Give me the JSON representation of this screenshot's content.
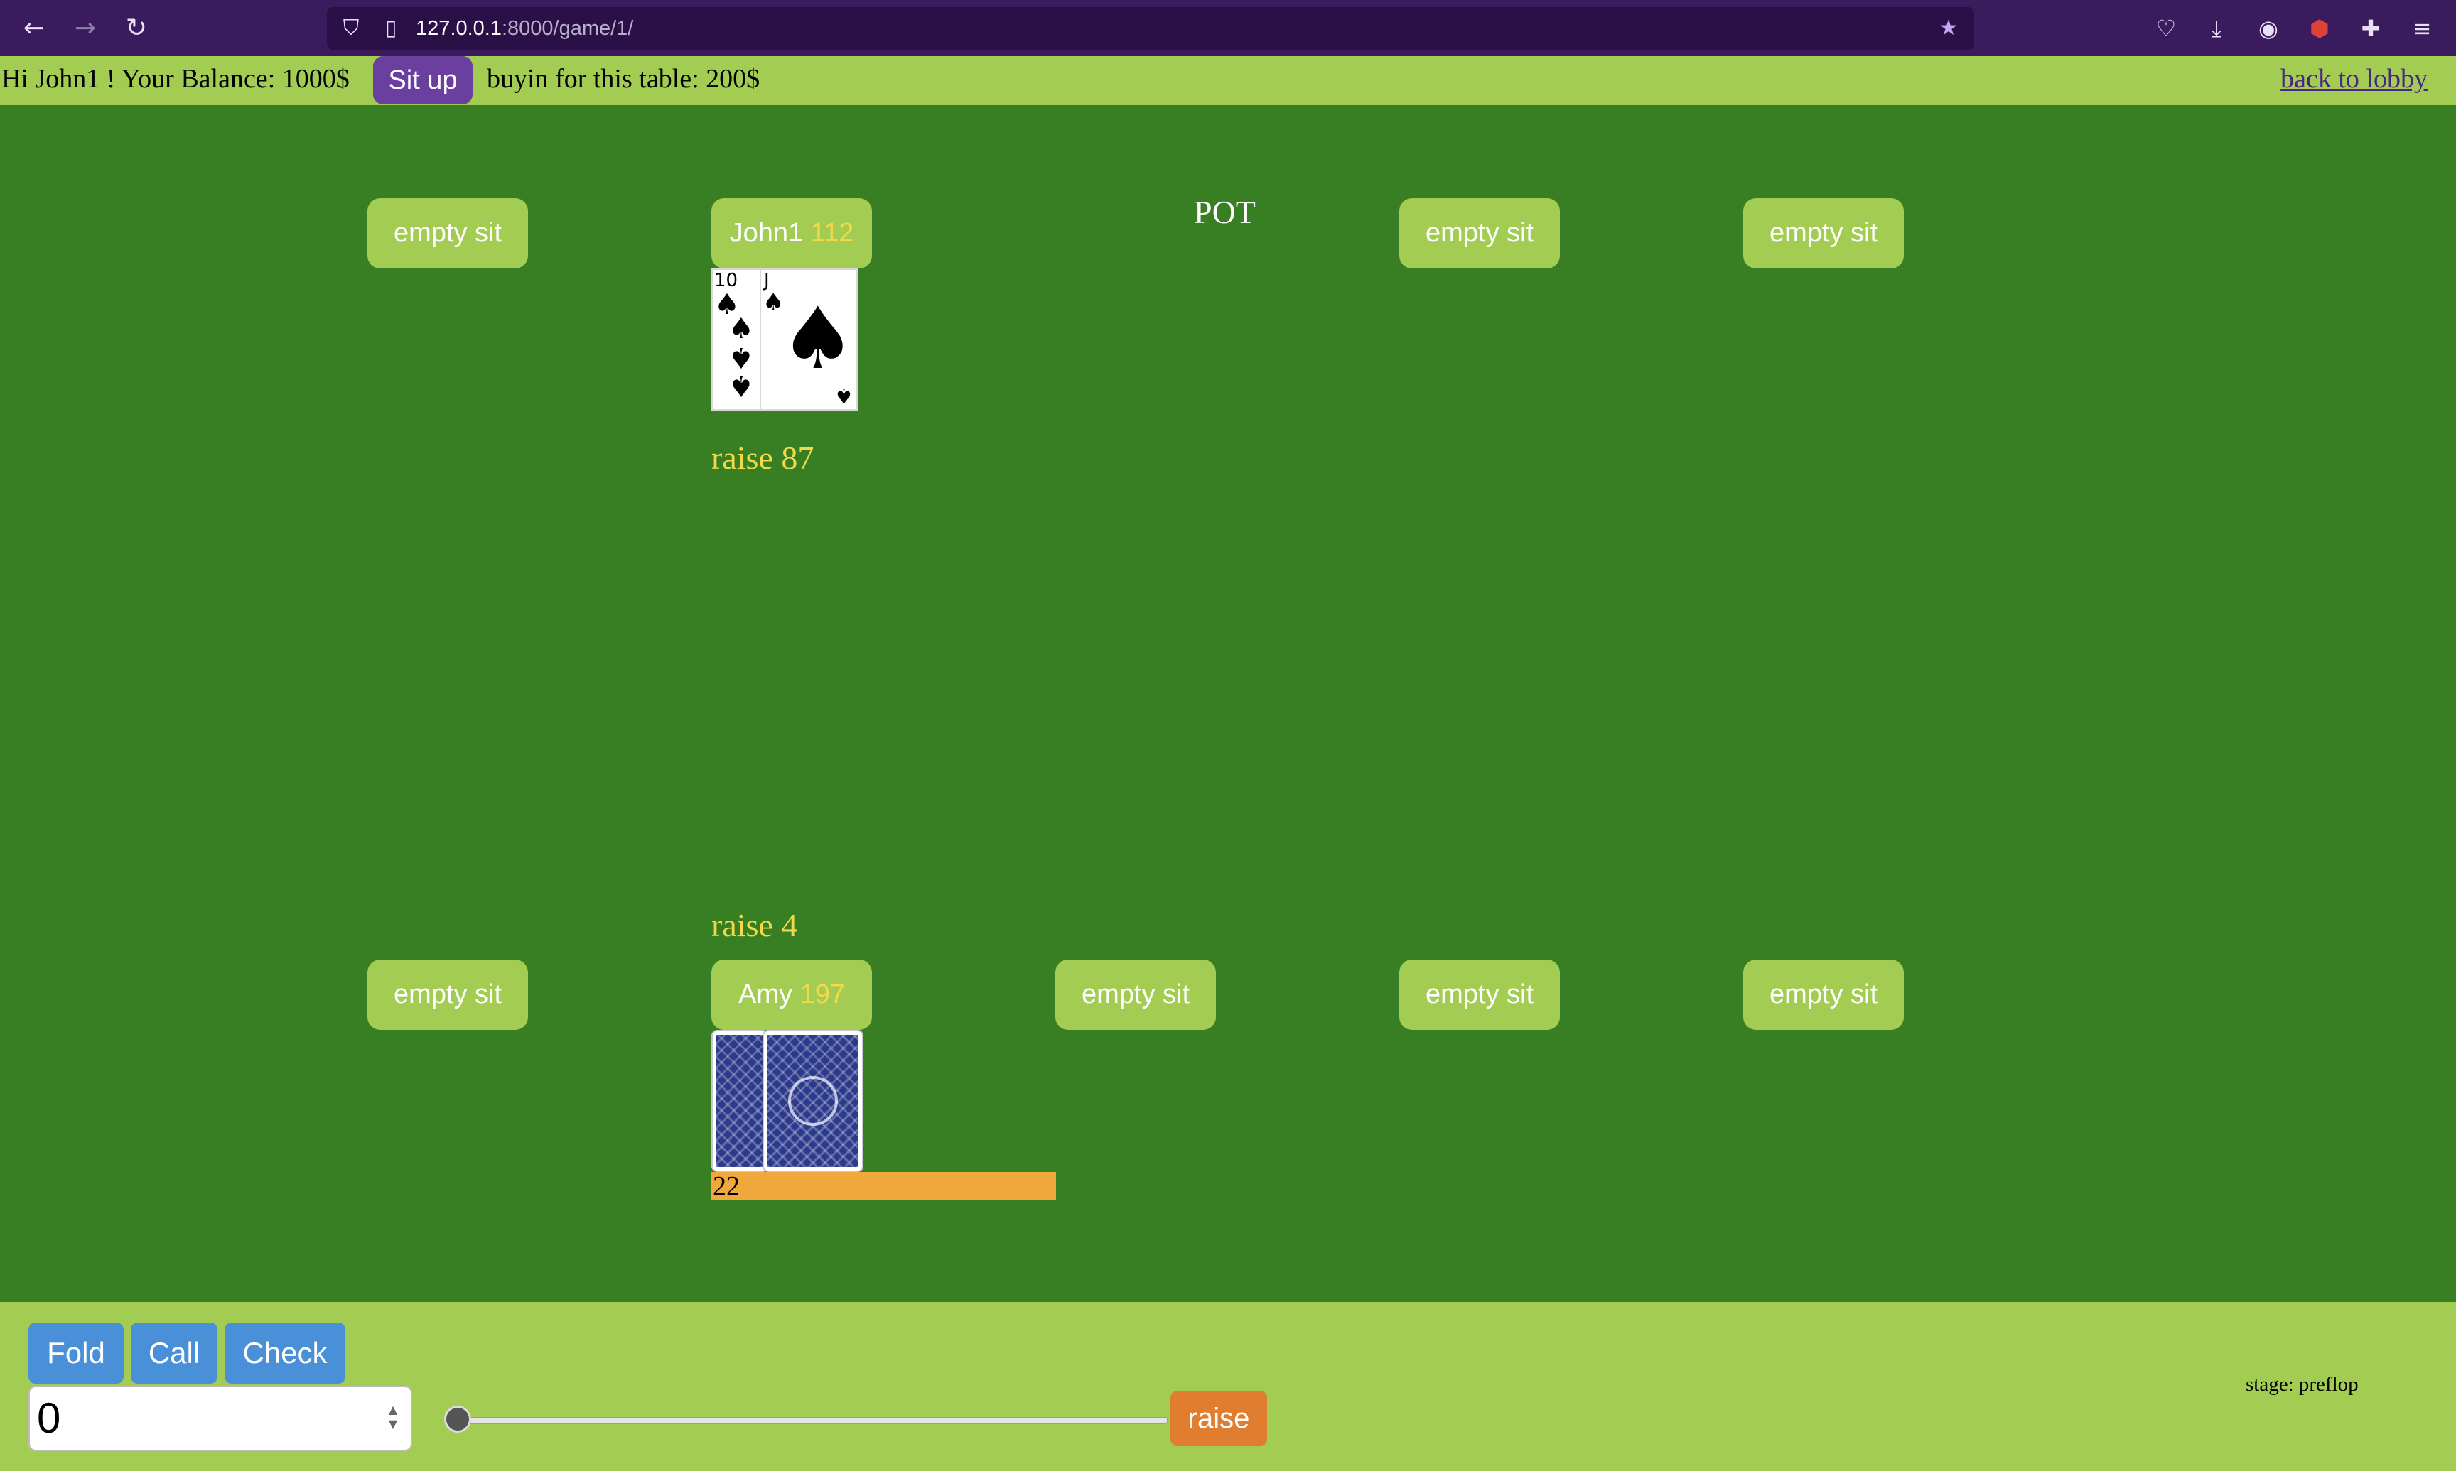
{
  "browser": {
    "url_host": "127.0.0.1",
    "url_rest": ":8000/game/1/",
    "icons": {
      "back": "back-arrow-icon",
      "forward": "forward-arrow-icon",
      "reload": "reload-icon",
      "shield": "shield-icon",
      "page": "page-icon",
      "bookmark": "star-icon",
      "pocket": "pocket-icon",
      "downloads": "download-icon",
      "account": "account-icon",
      "ublock": "ublock-icon",
      "extensions": "extensions-icon",
      "menu": "hamburger-menu-icon"
    }
  },
  "header": {
    "greeting": "Hi John1 ! Your Balance: 1000$",
    "sit_up_label": "Sit up",
    "buyin": "buyin for this table: 200$",
    "lobby_link": "back to lobby"
  },
  "table": {
    "pot_label": "POT",
    "top_seats": [
      {
        "empty_label": "empty sit"
      },
      {
        "name": "John1",
        "stack": "112",
        "action": "raise 87"
      },
      {
        "empty_label": "empty sit"
      },
      {
        "empty_label": "empty sit"
      }
    ],
    "bottom_seats": [
      {
        "empty_label": "empty sit"
      },
      {
        "name": "Amy",
        "stack": "197",
        "action": "raise 4"
      },
      {
        "empty_label": "empty sit"
      },
      {
        "empty_label": "empty sit"
      },
      {
        "empty_label": "empty sit"
      }
    ],
    "john_cards": [
      {
        "rank": "10",
        "suit": "♠"
      },
      {
        "rank": "J",
        "suit": "♠"
      }
    ],
    "timer_value": "22"
  },
  "controls": {
    "fold_label": "Fold",
    "call_label": "Call",
    "check_label": "Check",
    "amount_value": "0",
    "raise_label": "raise",
    "slider_value": 0,
    "stage": "stage: preflop"
  },
  "colors": {
    "felt": "#377f22",
    "bar": "#a3cd52",
    "stack": "#f3d84a",
    "action_blue": "#4a90d9",
    "raise_orange": "#e07d2e",
    "sit_up_purple": "#6b3fa0",
    "timer": "#f0a83c"
  }
}
